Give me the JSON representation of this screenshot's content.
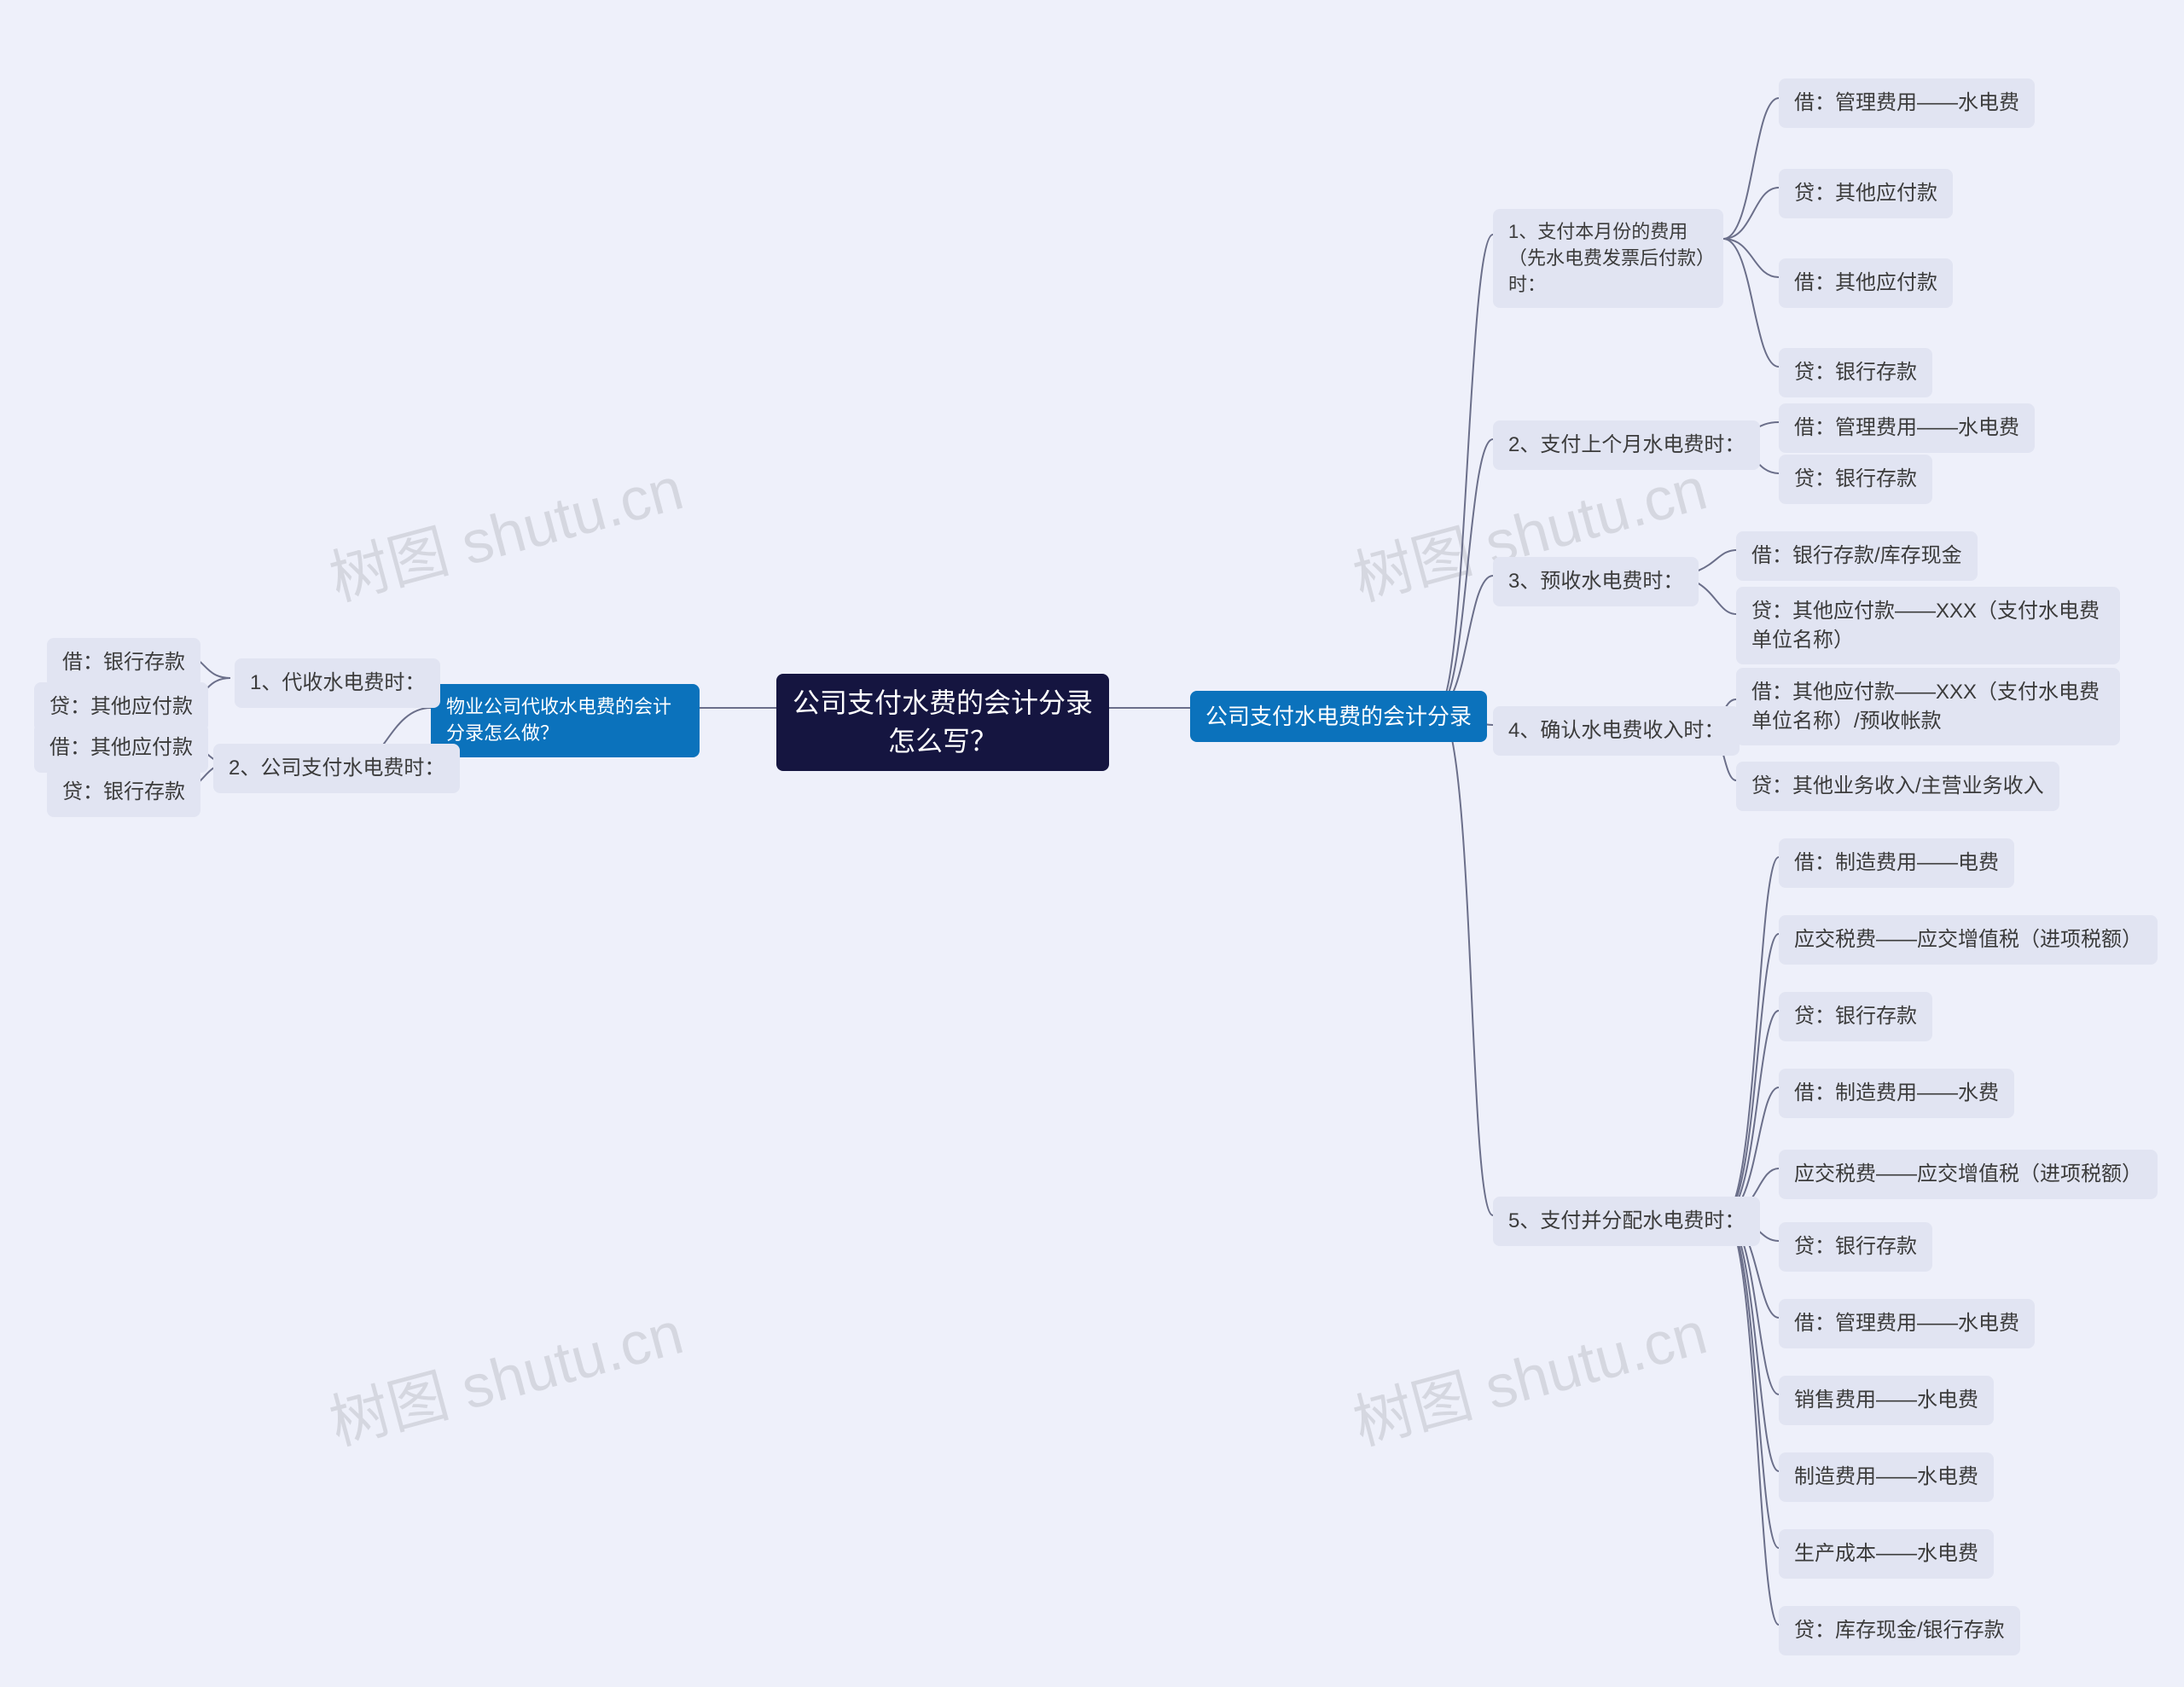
{
  "root": {
    "title": "公司支付水费的会计分录怎么写？"
  },
  "left_primary": {
    "title": "物业公司代收水电费的会计分录怎么做？"
  },
  "right_primary": {
    "title": "公司支付水电费的会计分录"
  },
  "left": {
    "m1": "1、代收水电费时：",
    "m1a": "借：银行存款",
    "m1b": "贷：其他应付款",
    "m2": "2、公司支付水电费时：",
    "m2a": "借：其他应付款",
    "m2b": "贷：银行存款"
  },
  "right": {
    "s1": "1、支付本月份的费用（先水电费发票后付款）时：",
    "s1a": "借：管理费用——水电费",
    "s1b": "贷：其他应付款",
    "s1c": "借：其他应付款",
    "s1d": "贷：银行存款",
    "s2": "2、支付上个月水电费时：",
    "s2a": "借：管理费用——水电费",
    "s2b": "贷：银行存款",
    "s3": "3、预收水电费时：",
    "s3a": "借：银行存款/库存现金",
    "s3b": "贷：其他应付款——XXX（支付水电费单位名称）",
    "s4": "4、确认水电费收入时：",
    "s4a": "借：其他应付款——XXX（支付水电费单位名称）/预收帐款",
    "s4b": "贷：其他业务收入/主营业务收入",
    "s5": "5、支付并分配水电费时：",
    "s5a": "借：制造费用——电费",
    "s5b": "应交税费——应交增值税（进项税额）",
    "s5c": "贷：银行存款",
    "s5d": "借：制造费用——水费",
    "s5e": "应交税费——应交增值税（进项税额）",
    "s5f": "贷：银行存款",
    "s5g": "借：管理费用——水电费",
    "s5h": "销售费用——水电费",
    "s5i": "制造费用——水电费",
    "s5j": "生产成本——水电费",
    "s5k": "贷：库存现金/银行存款"
  },
  "watermark": "树图 shutu.cn",
  "chart_data": {
    "type": "mindmap",
    "root": "公司支付水费的会计分录怎么写？",
    "branches": [
      {
        "side": "left",
        "title": "物业公司代收水电费的会计分录怎么做？",
        "children": [
          {
            "title": "1、代收水电费时：",
            "children": [
              "借：银行存款",
              "贷：其他应付款"
            ]
          },
          {
            "title": "2、公司支付水电费时：",
            "children": [
              "借：其他应付款",
              "贷：银行存款"
            ]
          }
        ]
      },
      {
        "side": "right",
        "title": "公司支付水电费的会计分录",
        "children": [
          {
            "title": "1、支付本月份的费用（先水电费发票后付款）时：",
            "children": [
              "借：管理费用——水电费",
              "贷：其他应付款",
              "借：其他应付款",
              "贷：银行存款"
            ]
          },
          {
            "title": "2、支付上个月水电费时：",
            "children": [
              "借：管理费用——水电费",
              "贷：银行存款"
            ]
          },
          {
            "title": "3、预收水电费时：",
            "children": [
              "借：银行存款/库存现金",
              "贷：其他应付款——XXX（支付水电费单位名称）"
            ]
          },
          {
            "title": "4、确认水电费收入时：",
            "children": [
              "借：其他应付款——XXX（支付水电费单位名称）/预收帐款",
              "贷：其他业务收入/主营业务收入"
            ]
          },
          {
            "title": "5、支付并分配水电费时：",
            "children": [
              "借：制造费用——电费",
              "应交税费——应交增值税（进项税额）",
              "贷：银行存款",
              "借：制造费用——水费",
              "应交税费——应交增值税（进项税额）",
              "贷：银行存款",
              "借：管理费用——水电费",
              "销售费用——水电费",
              "制造费用——水电费",
              "生产成本——水电费",
              "贷：库存现金/银行存款"
            ]
          }
        ]
      }
    ]
  }
}
